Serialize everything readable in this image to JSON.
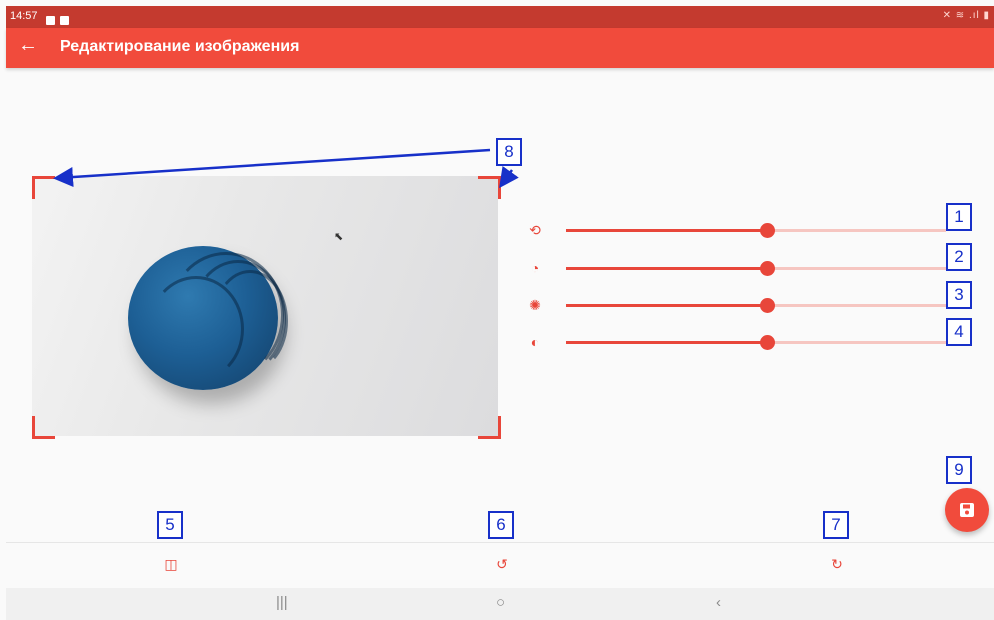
{
  "status_bar": {
    "time": "14:57"
  },
  "app_bar": {
    "title": "Редактирование изображения"
  },
  "sliders": [
    {
      "icon": "crop-rotate-icon",
      "level": 0.53
    },
    {
      "icon": "palette-icon",
      "level": 0.53
    },
    {
      "icon": "brightness-icon",
      "level": 0.53
    },
    {
      "icon": "contrast-icon",
      "level": 0.53
    }
  ],
  "annotations": [
    "1",
    "2",
    "3",
    "4",
    "5",
    "6",
    "7",
    "8",
    "9"
  ],
  "toolbar": {
    "flip_icon": "flip-icon",
    "rotate_left_icon": "rotate-left-icon",
    "rotate_right_icon": "rotate-right-icon",
    "save_icon": "save-icon"
  },
  "colors": {
    "accent": "#f14b3c",
    "status_bar": "#c43a2f",
    "annotation": "#1730c9"
  }
}
